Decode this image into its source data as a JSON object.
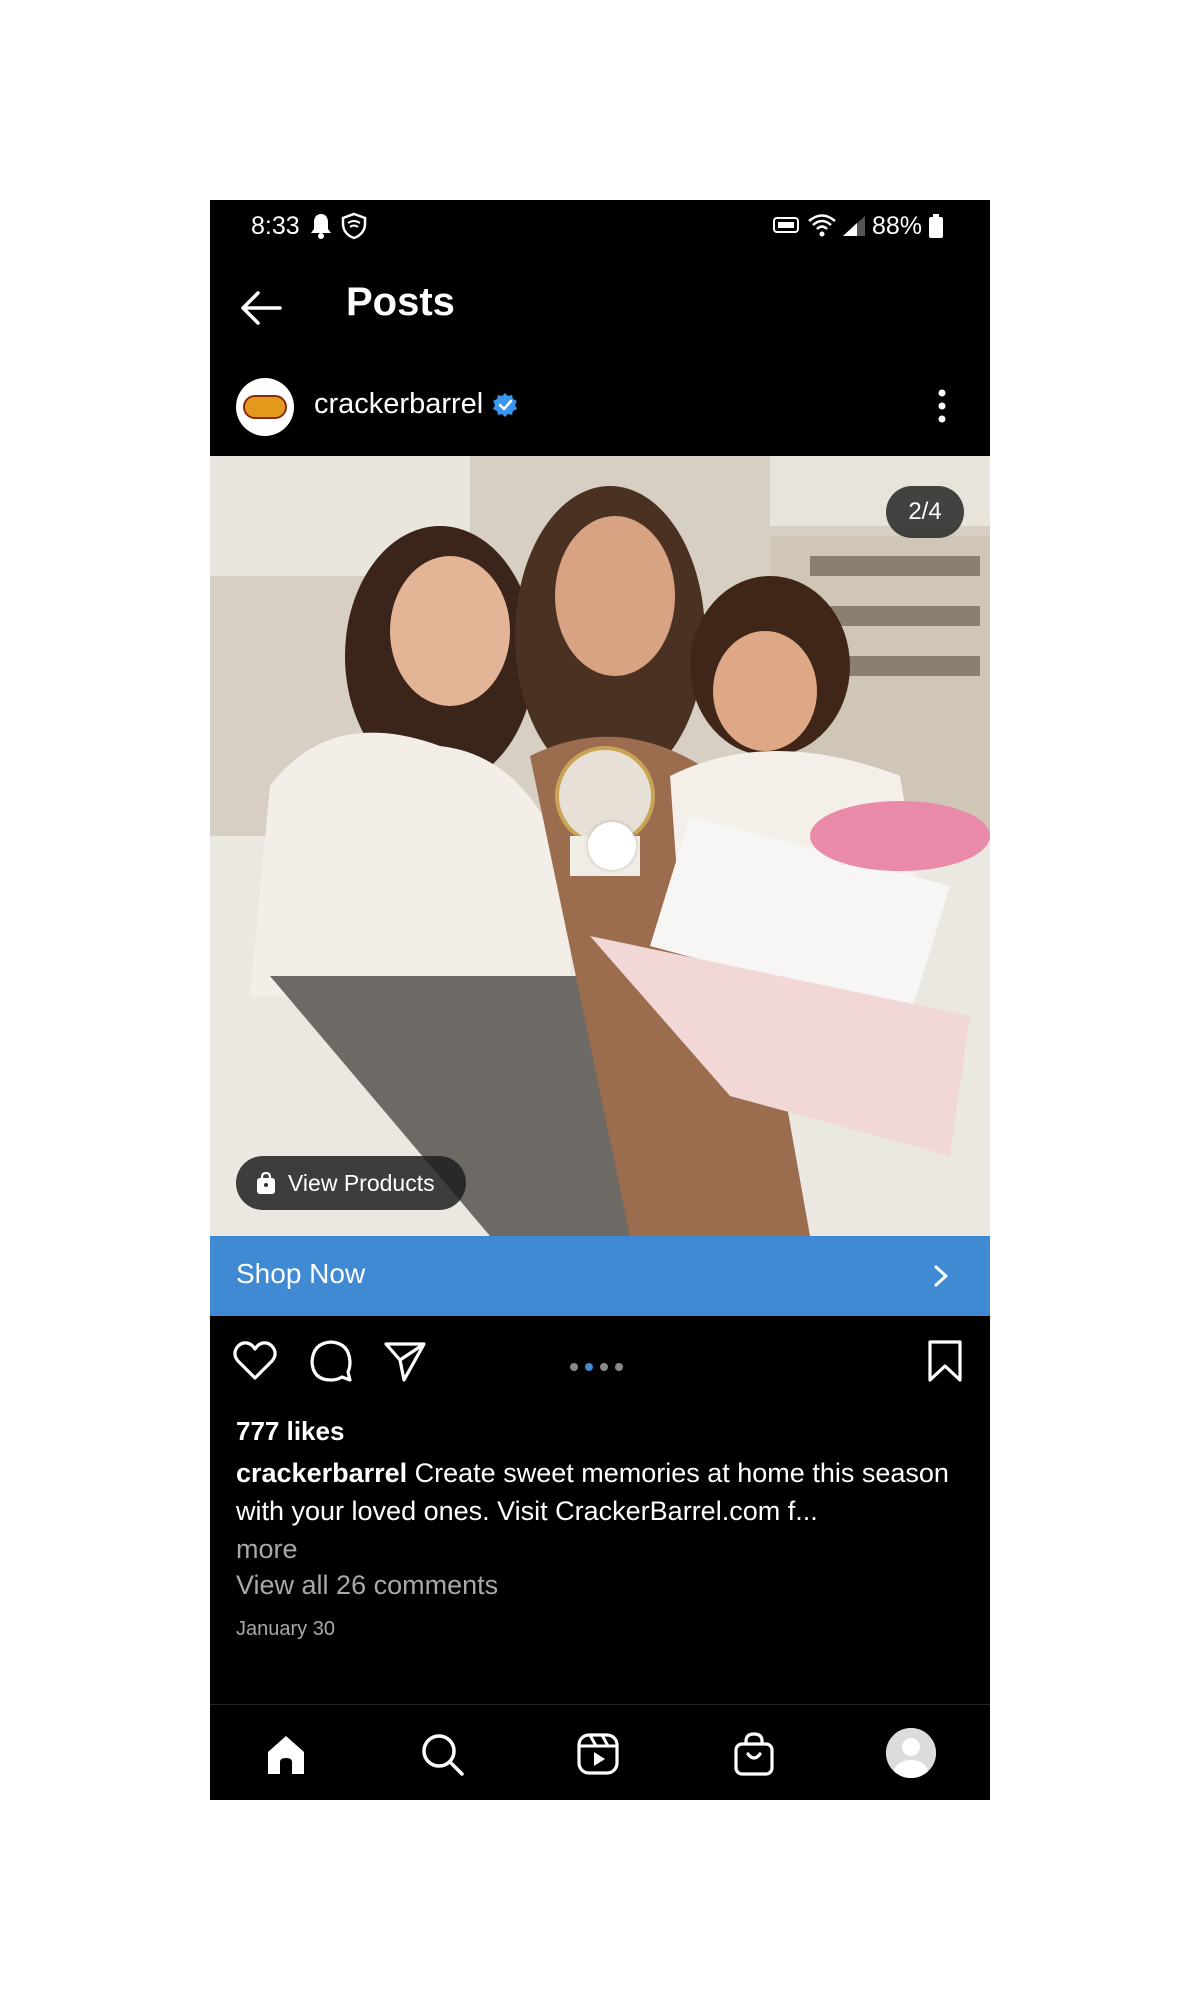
{
  "status_bar": {
    "time": "8:33",
    "battery": "88%",
    "icons": [
      "bell-icon",
      "shield-icon",
      "volte-icon",
      "wifi-icon",
      "signal-icon",
      "battery-icon"
    ]
  },
  "header": {
    "title": "Posts",
    "back_icon": "arrow-left-icon"
  },
  "post": {
    "username": "crackerbarrel",
    "verified": true,
    "logo_text": "Cracker Barrel",
    "counter": "2/4",
    "view_products_label": "View Products",
    "shop_now_label": "Shop Now",
    "likes": "777 likes",
    "caption_user": "crackerbarrel",
    "caption_text": "Create sweet memories at home this season with your loved ones.  Visit CrackerBarrel.com f...",
    "more_label": "more",
    "comments_label": "View all 26 comments",
    "date": "January 30",
    "carousel": {
      "count": 4,
      "active_index": 1
    }
  },
  "bottom_nav": {
    "items": [
      "home-icon",
      "search-icon",
      "reels-icon",
      "shop-icon",
      "profile-avatar"
    ]
  },
  "colors": {
    "background": "#000000",
    "accent": "#3f8ad2",
    "secondary_text": "#a8a8a8",
    "verified": "#3897f0"
  }
}
